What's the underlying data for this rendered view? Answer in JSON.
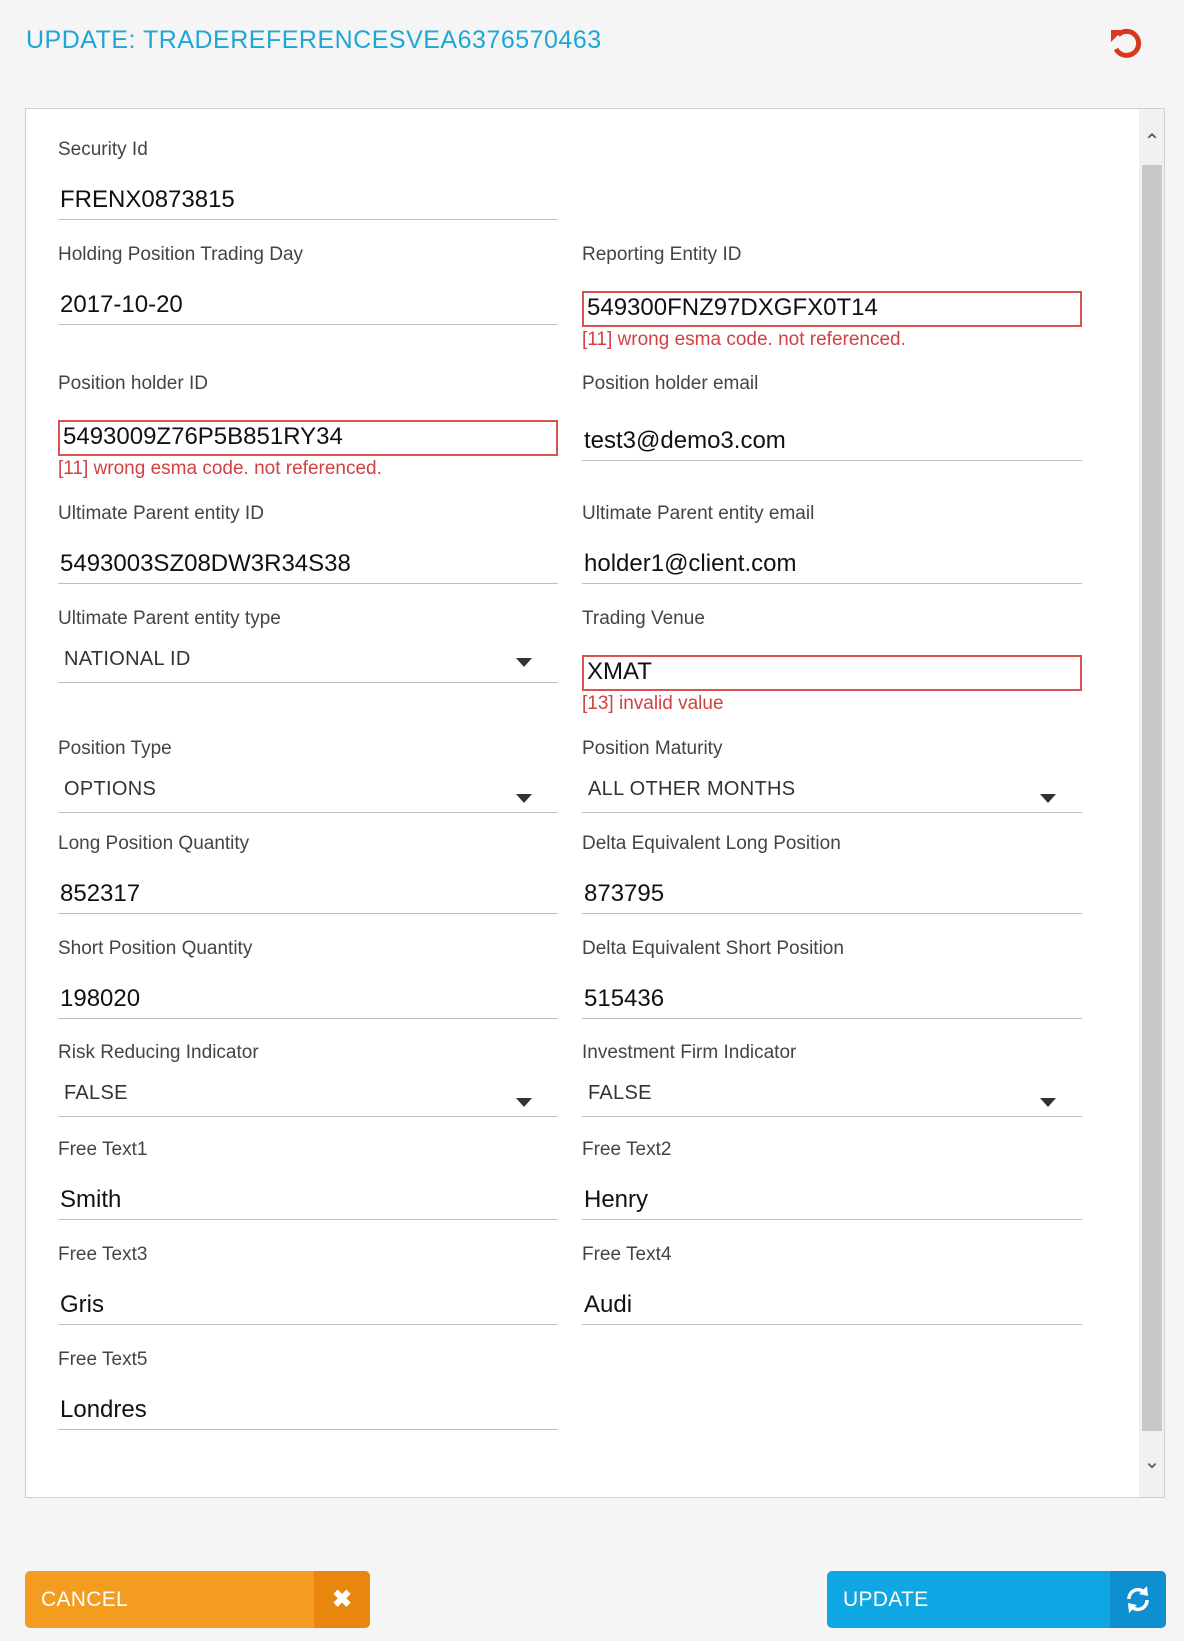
{
  "header": {
    "title": "UPDATE: TRADEREFERENCESVEA6376570463",
    "reset_icon": "undo-icon"
  },
  "form": {
    "security_id": {
      "label": "Security Id",
      "value": "FRENX0873815"
    },
    "holding_position_trading_day": {
      "label": "Holding Position Trading Day",
      "value": "2017-10-20"
    },
    "reporting_entity_id": {
      "label": "Reporting Entity ID",
      "value": "549300FNZ97DXGFX0T14",
      "error": "[11] wrong esma code. not referenced."
    },
    "position_holder_id": {
      "label": "Position holder ID",
      "value": "5493009Z76P5B851RY34",
      "error": "[11] wrong esma code. not referenced."
    },
    "position_holder_email": {
      "label": "Position holder email",
      "value": "test3@demo3.com"
    },
    "ultimate_parent_entity_id": {
      "label": "Ultimate Parent entity ID",
      "value": "5493003SZ08DW3R34S38"
    },
    "ultimate_parent_entity_email": {
      "label": "Ultimate Parent entity email",
      "value": "holder1@client.com"
    },
    "ultimate_parent_entity_type": {
      "label": "Ultimate Parent entity type",
      "value": "NATIONAL ID"
    },
    "trading_venue": {
      "label": "Trading Venue",
      "value": "XMAT",
      "error": "[13] invalid value"
    },
    "position_type": {
      "label": "Position Type",
      "value": "OPTIONS"
    },
    "position_maturity": {
      "label": "Position Maturity",
      "value": "ALL OTHER MONTHS"
    },
    "long_position_quantity": {
      "label": "Long Position Quantity",
      "value": "852317"
    },
    "delta_equivalent_long_position": {
      "label": "Delta Equivalent Long Position",
      "value": "873795"
    },
    "short_position_quantity": {
      "label": "Short Position Quantity",
      "value": "198020"
    },
    "delta_equivalent_short_position": {
      "label": "Delta Equivalent Short Position",
      "value": "515436"
    },
    "risk_reducing_indicator": {
      "label": "Risk Reducing Indicator",
      "value": "FALSE"
    },
    "investment_firm_indicator": {
      "label": "Investment Firm Indicator",
      "value": "FALSE"
    },
    "free_text1": {
      "label": "Free Text1",
      "value": "Smith"
    },
    "free_text2": {
      "label": "Free Text2",
      "value": "Henry"
    },
    "free_text3": {
      "label": "Free Text3",
      "value": "Gris"
    },
    "free_text4": {
      "label": "Free Text4",
      "value": "Audi"
    },
    "free_text5": {
      "label": "Free Text5",
      "value": "Londres"
    }
  },
  "footer": {
    "cancel_label": "CANCEL",
    "cancel_icon": "close-icon",
    "update_label": "UPDATE",
    "update_icon": "refresh-icon"
  },
  "colors": {
    "accent": "#1ea6d6",
    "error": "#d9534f",
    "cancel": "#f39c1f",
    "update": "#0fa6e4"
  }
}
